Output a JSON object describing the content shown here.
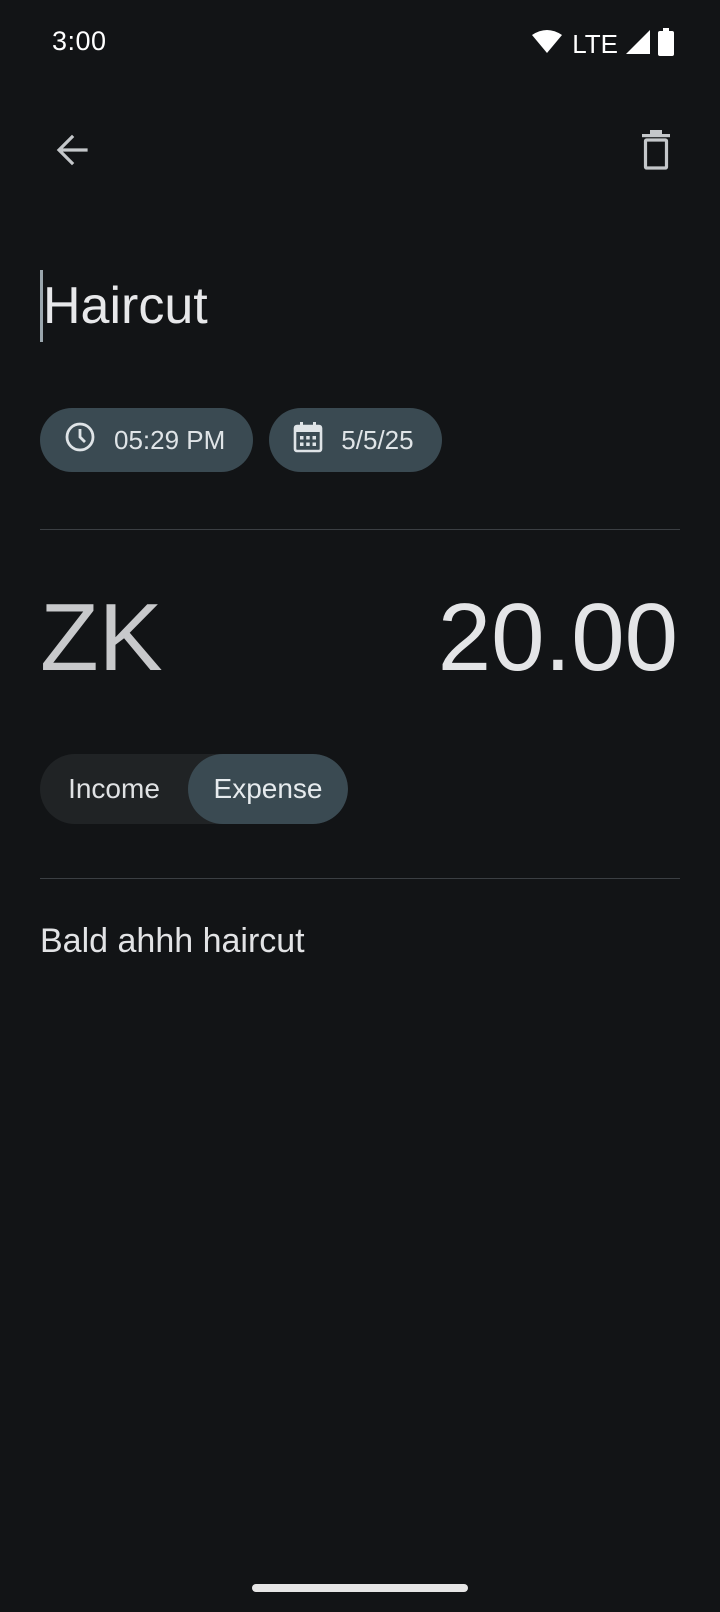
{
  "status_bar": {
    "time": "3:00",
    "network": "LTE",
    "icons": [
      "wifi-icon",
      "cellular-signal-icon",
      "battery-icon"
    ]
  },
  "app_bar": {
    "back_icon": "arrow-left-icon",
    "delete_icon": "trash-icon"
  },
  "transaction": {
    "title": "Haircut",
    "time": "05:29 PM",
    "date": "5/5/25",
    "currency": "ZK",
    "amount": "20.00",
    "note": "Bald ahhh haircut"
  },
  "type_toggle": {
    "options": [
      "Income",
      "Expense"
    ],
    "selected": "Expense"
  },
  "colors": {
    "background": "#121416",
    "chip": "#3a4a52",
    "toggle_track": "#202325",
    "divider": "#3b3f43"
  }
}
